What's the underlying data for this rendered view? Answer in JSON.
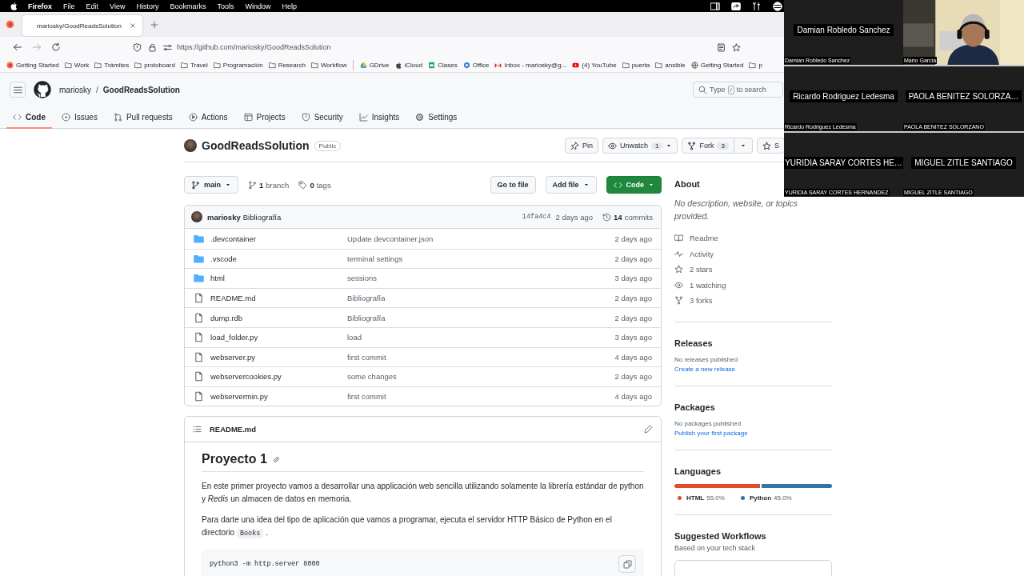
{
  "menu_bar": {
    "app": "Firefox",
    "items": [
      "File",
      "Edit",
      "View",
      "History",
      "Bookmarks",
      "Tools",
      "Window",
      "Help"
    ]
  },
  "browser": {
    "tab_title": "mariosky/GoodReadsSolution",
    "url": "https://github.com/mariosky/GoodReadsSolution",
    "bookmarks": [
      {
        "kind": "firefox",
        "label": "Getting Started"
      },
      {
        "kind": "folder",
        "label": "Work"
      },
      {
        "kind": "folder",
        "label": "Trámites"
      },
      {
        "kind": "folder",
        "label": "protoboard"
      },
      {
        "kind": "folder",
        "label": "Travel"
      },
      {
        "kind": "folder",
        "label": "Programación"
      },
      {
        "kind": "folder",
        "label": "Research"
      },
      {
        "kind": "folder",
        "label": "Workflow"
      },
      {
        "kind": "separator"
      },
      {
        "kind": "drive",
        "label": "GDrive"
      },
      {
        "kind": "apple",
        "label": "iCloud"
      },
      {
        "kind": "sheet",
        "label": "Clases"
      },
      {
        "kind": "office",
        "label": "Office"
      },
      {
        "kind": "mail",
        "label": "Inbox - mariosky@g..."
      },
      {
        "kind": "video",
        "label": "(4) YouTube"
      },
      {
        "kind": "folder",
        "label": "puerta"
      },
      {
        "kind": "folder",
        "label": "ansible"
      },
      {
        "kind": "globe",
        "label": "Getting Started"
      },
      {
        "kind": "folder",
        "label": "p"
      }
    ]
  },
  "header": {
    "owner": "mariosky",
    "separator": "/",
    "repo": "GoodReadsSolution",
    "search": {
      "before": "Type",
      "key": "/",
      "after": "to search"
    }
  },
  "repo_tabs": [
    {
      "kind": "code",
      "label": "Code",
      "selected": true
    },
    {
      "kind": "issue",
      "label": "Issues",
      "selected": false
    },
    {
      "kind": "pull",
      "label": "Pull requests",
      "selected": false
    },
    {
      "kind": "play",
      "label": "Actions",
      "selected": false
    },
    {
      "kind": "table",
      "label": "Projects",
      "selected": false
    },
    {
      "kind": "shield",
      "label": "Security",
      "selected": false
    },
    {
      "kind": "graph",
      "label": "Insights",
      "selected": false
    },
    {
      "kind": "gear",
      "label": "Settings",
      "selected": false
    }
  ],
  "repo": {
    "name": "GoodReadsSolution",
    "visibility": "Public",
    "actions": [
      {
        "kind": "pin",
        "label": "Pin"
      },
      {
        "kind": "eye",
        "label": "Unwatch",
        "count": "1"
      },
      {
        "kind": "fork",
        "label": "Fork",
        "count": "3"
      },
      {
        "kind": "star",
        "label": "S"
      }
    ]
  },
  "branch_bar": {
    "branch": "main",
    "branches": {
      "count": "1",
      "label": "branch"
    },
    "tags": {
      "count": "0",
      "label": "tags"
    },
    "buttons": [
      {
        "kind": "plain",
        "label": "Go to file"
      },
      {
        "kind": "menu",
        "label": "Add file"
      },
      {
        "kind": "primary",
        "label": "Code"
      }
    ]
  },
  "latest_commit": {
    "author": "mariosky",
    "message": "Bibliografía",
    "sha": "14fa4c4",
    "time": "2 days ago",
    "commits": {
      "count": "14",
      "label": "commits"
    }
  },
  "files": [
    {
      "kind": "dir",
      "name": ".devcontainer",
      "message": "Update devcontainer.json",
      "time": "2 days ago"
    },
    {
      "kind": "dir",
      "name": ".vscode",
      "message": "terminal settings",
      "time": "2 days ago"
    },
    {
      "kind": "dir",
      "name": "html",
      "message": "sessions",
      "time": "3 days ago"
    },
    {
      "kind": "file",
      "name": "README.md",
      "message": "Bibliografía",
      "time": "2 days ago"
    },
    {
      "kind": "file",
      "name": "dump.rdb",
      "message": "Bibliografía",
      "time": "2 days ago"
    },
    {
      "kind": "file",
      "name": "load_folder.py",
      "message": "load",
      "time": "3 days ago"
    },
    {
      "kind": "file",
      "name": "webserver.py",
      "message": "first commit",
      "time": "4 days ago"
    },
    {
      "kind": "file",
      "name": "webservercookies.py",
      "message": "some changes",
      "time": "2 days ago"
    },
    {
      "kind": "file",
      "name": "webservermin.py",
      "message": "first commit",
      "time": "4 days ago"
    }
  ],
  "readme": {
    "title": "README.md",
    "heading": "Proyecto 1",
    "paragraphs": [
      {
        "text": "En este primer proyecto vamos a desarrollar una applicación web sencilla utilizando solamente la librería estándar de python y *Redis* un almacen de datos en memoria."
      },
      {
        "text": "Para darte una idea del tipo de aplicación que vamos a programar, ejecuta el servidor HTTP Básico de Python en el directorio",
        "code": "Books",
        "after": "."
      }
    ],
    "code_block": "python3 -m http.server 8000"
  },
  "sidebar": {
    "about": {
      "title": "About",
      "description": "No description, website, or topics provided.",
      "links": [
        {
          "kind": "book",
          "label": "Readme"
        },
        {
          "kind": "pulse",
          "label": "Activity"
        },
        {
          "kind": "star",
          "label": "2 stars"
        },
        {
          "kind": "eye",
          "label": "1 watching"
        },
        {
          "kind": "fork",
          "label": "3 forks"
        }
      ]
    },
    "releases": {
      "title": "Releases",
      "note": "No releases published",
      "link": "Create a new release"
    },
    "packages": {
      "title": "Packages",
      "note": "No packages published",
      "link": "Publish your first package"
    },
    "languages": {
      "title": "Languages",
      "items": [
        {
          "name": "HTML",
          "percent": "55.0%",
          "level": 0.55,
          "color": "#e34c26"
        },
        {
          "name": "Python",
          "percent": "45.0%",
          "level": 0.45,
          "color": "#3572a5"
        }
      ]
    },
    "workflows": {
      "title": "Suggested Workflows",
      "subtitle": "Based on your tech stack"
    }
  },
  "participants": [
    {
      "kind": "name",
      "tile_name": "Damian Robledo Sanchez",
      "label": "Damian Robledo Sanchez"
    },
    {
      "kind": "video",
      "label": "Mario Garcia"
    },
    {
      "kind": "name",
      "tile_name": "Ricardo Rodriguez Ledesma",
      "label": "Ricardo Rodriguez Ledesma"
    },
    {
      "kind": "name",
      "tile_name": "PAOLA BENITEZ SOLORZA…",
      "label": "PAOLA BENITEZ SOLORZANO"
    },
    {
      "kind": "name",
      "tile_name": "YURIDIA SARAY CORTES HE…",
      "label": "YURIDIA SARAY CORTES HERNANDEZ"
    },
    {
      "kind": "name",
      "tile_name": "MIGUEL ZITLE SANTIAGO",
      "label": "MIGUEL ZITLE SANTIAGO"
    }
  ]
}
